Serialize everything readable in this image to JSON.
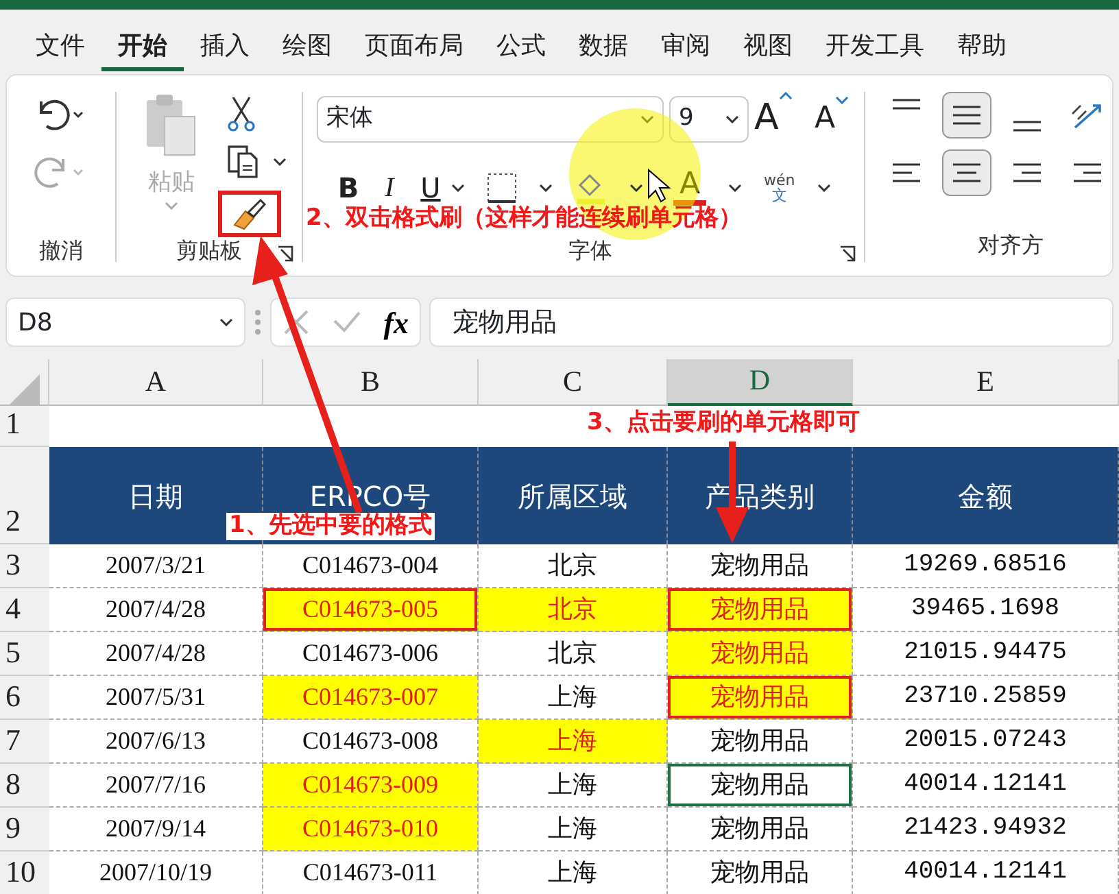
{
  "menu_tabs": [
    {
      "label": "文件",
      "selected": false
    },
    {
      "label": "开始",
      "selected": true
    },
    {
      "label": "插入",
      "selected": false
    },
    {
      "label": "绘图",
      "selected": false
    },
    {
      "label": "页面布局",
      "selected": false
    },
    {
      "label": "公式",
      "selected": false
    },
    {
      "label": "数据",
      "selected": false
    },
    {
      "label": "审阅",
      "selected": false
    },
    {
      "label": "视图",
      "selected": false
    },
    {
      "label": "开发工具",
      "selected": false
    },
    {
      "label": "帮助",
      "selected": false
    }
  ],
  "ribbon": {
    "undo": {
      "label": "撤消"
    },
    "clipboard": {
      "paste_label": "粘贴",
      "label": "剪贴板"
    },
    "font": {
      "name": "宋体",
      "size": "9",
      "bold": "B",
      "italic": "I",
      "underline": "U",
      "font_color": "A",
      "grow": "A",
      "shrink": "A",
      "phonetic_top": "wén",
      "phonetic_bottom": "文",
      "label": "字体"
    },
    "alignment": {
      "label": "对齐方"
    }
  },
  "formula_bar": {
    "name_box": "D8",
    "fx": "fx",
    "content": "宠物用品"
  },
  "sheet": {
    "columns": [
      {
        "label": "A",
        "selected": false
      },
      {
        "label": "B",
        "selected": false
      },
      {
        "label": "C",
        "selected": false
      },
      {
        "label": "D",
        "selected": true
      },
      {
        "label": "E",
        "selected": false
      }
    ],
    "header_row": {
      "number": "2",
      "cells": [
        "日期",
        "ERPCO号",
        "所属区域",
        "产品类别",
        "金额"
      ]
    },
    "empty_row": {
      "number": "1"
    },
    "rows": [
      {
        "number": "3",
        "cells": [
          {
            "text": "2007/3/21",
            "highlighted": false,
            "boxed": false,
            "selected": false
          },
          {
            "text": "C014673-004",
            "highlighted": false,
            "boxed": false,
            "selected": false
          },
          {
            "text": "北京",
            "highlighted": false,
            "boxed": false,
            "selected": false
          },
          {
            "text": "宠物用品",
            "highlighted": false,
            "boxed": false,
            "selected": false
          },
          {
            "text": "19269.68516",
            "highlighted": false,
            "boxed": false,
            "selected": false
          }
        ]
      },
      {
        "number": "4",
        "cells": [
          {
            "text": "2007/4/28",
            "highlighted": false,
            "boxed": false,
            "selected": false
          },
          {
            "text": "C014673-005",
            "highlighted": true,
            "boxed": true,
            "selected": false
          },
          {
            "text": "北京",
            "highlighted": true,
            "boxed": false,
            "selected": false
          },
          {
            "text": "宠物用品",
            "highlighted": true,
            "boxed": true,
            "selected": false
          },
          {
            "text": "39465.1698",
            "highlighted": false,
            "boxed": false,
            "selected": false
          }
        ]
      },
      {
        "number": "5",
        "cells": [
          {
            "text": "2007/4/28",
            "highlighted": false,
            "boxed": false,
            "selected": false
          },
          {
            "text": "C014673-006",
            "highlighted": false,
            "boxed": false,
            "selected": false
          },
          {
            "text": "北京",
            "highlighted": false,
            "boxed": false,
            "selected": false
          },
          {
            "text": "宠物用品",
            "highlighted": true,
            "boxed": false,
            "selected": false
          },
          {
            "text": "21015.94475",
            "highlighted": false,
            "boxed": false,
            "selected": false
          }
        ]
      },
      {
        "number": "6",
        "cells": [
          {
            "text": "2007/5/31",
            "highlighted": false,
            "boxed": false,
            "selected": false
          },
          {
            "text": "C014673-007",
            "highlighted": true,
            "boxed": false,
            "selected": false
          },
          {
            "text": "上海",
            "highlighted": false,
            "boxed": false,
            "selected": false
          },
          {
            "text": "宠物用品",
            "highlighted": true,
            "boxed": true,
            "selected": false
          },
          {
            "text": "23710.25859",
            "highlighted": false,
            "boxed": false,
            "selected": false
          }
        ]
      },
      {
        "number": "7",
        "cells": [
          {
            "text": "2007/6/13",
            "highlighted": false,
            "boxed": false,
            "selected": false
          },
          {
            "text": "C014673-008",
            "highlighted": false,
            "boxed": false,
            "selected": false
          },
          {
            "text": "上海",
            "highlighted": true,
            "boxed": false,
            "selected": false
          },
          {
            "text": "宠物用品",
            "highlighted": false,
            "boxed": false,
            "selected": false
          },
          {
            "text": "20015.07243",
            "highlighted": false,
            "boxed": false,
            "selected": false
          }
        ]
      },
      {
        "number": "8",
        "cells": [
          {
            "text": "2007/7/16",
            "highlighted": false,
            "boxed": false,
            "selected": false
          },
          {
            "text": "C014673-009",
            "highlighted": true,
            "boxed": false,
            "selected": false
          },
          {
            "text": "上海",
            "highlighted": false,
            "boxed": false,
            "selected": false
          },
          {
            "text": "宠物用品",
            "highlighted": false,
            "boxed": false,
            "selected": true
          },
          {
            "text": "40014.12141",
            "highlighted": false,
            "boxed": false,
            "selected": false
          }
        ]
      },
      {
        "number": "9",
        "cells": [
          {
            "text": "2007/9/14",
            "highlighted": false,
            "boxed": false,
            "selected": false
          },
          {
            "text": "C014673-010",
            "highlighted": true,
            "boxed": false,
            "selected": false
          },
          {
            "text": "上海",
            "highlighted": false,
            "boxed": false,
            "selected": false
          },
          {
            "text": "宠物用品",
            "highlighted": false,
            "boxed": false,
            "selected": false
          },
          {
            "text": "21423.94932",
            "highlighted": false,
            "boxed": false,
            "selected": false
          }
        ]
      },
      {
        "number": "10",
        "cells": [
          {
            "text": "2007/10/19",
            "highlighted": false,
            "boxed": false,
            "selected": false
          },
          {
            "text": "C014673-011",
            "highlighted": false,
            "boxed": false,
            "selected": false
          },
          {
            "text": "上海",
            "highlighted": false,
            "boxed": false,
            "selected": false
          },
          {
            "text": "宠物用品",
            "highlighted": false,
            "boxed": false,
            "selected": false
          },
          {
            "text": "40014.12141",
            "highlighted": false,
            "boxed": false,
            "selected": false
          }
        ]
      }
    ]
  },
  "annotations": [
    {
      "text": "1、先选中要的格式"
    },
    {
      "text": "2、双击格式刷（这样才能连续刷单元格）"
    },
    {
      "text": "3、点击要刷的单元格即可"
    }
  ]
}
